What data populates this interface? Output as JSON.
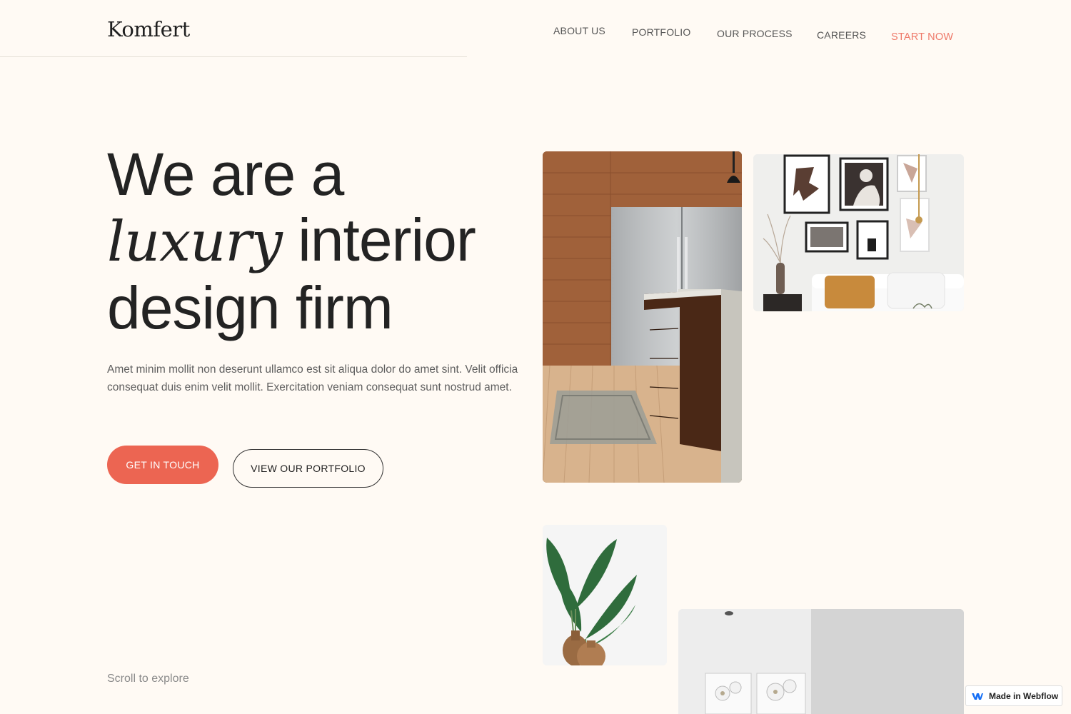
{
  "header": {
    "logo": "Komfert",
    "nav": {
      "about": "ABOUT US",
      "portfolio": "PORTFOLIO",
      "process": "OUR PROCESS",
      "careers": "CAREERS",
      "start": "START NOW"
    }
  },
  "hero": {
    "title_line1": "We are a",
    "title_italic": "luxury",
    "title_line2_rest": "interior",
    "title_line3": "design firm",
    "description": "Amet minim mollit non deserunt ullamco est sit aliqua dolor do amet sint. Velit officia consequat duis enim velit mollit. Exercitation veniam consequat sunt nostrud amet.",
    "cta_primary": "GET IN TOUCH",
    "cta_secondary": "VIEW OUR PORTFOLIO",
    "scroll_hint": "Scroll to explore"
  },
  "badge": {
    "label": "Made in Webflow",
    "icon": "webflow-icon"
  },
  "colors": {
    "background": "#fffaf4",
    "accent": "#ec6552",
    "nav_accent": "#ee7a6a",
    "text": "#232323"
  }
}
